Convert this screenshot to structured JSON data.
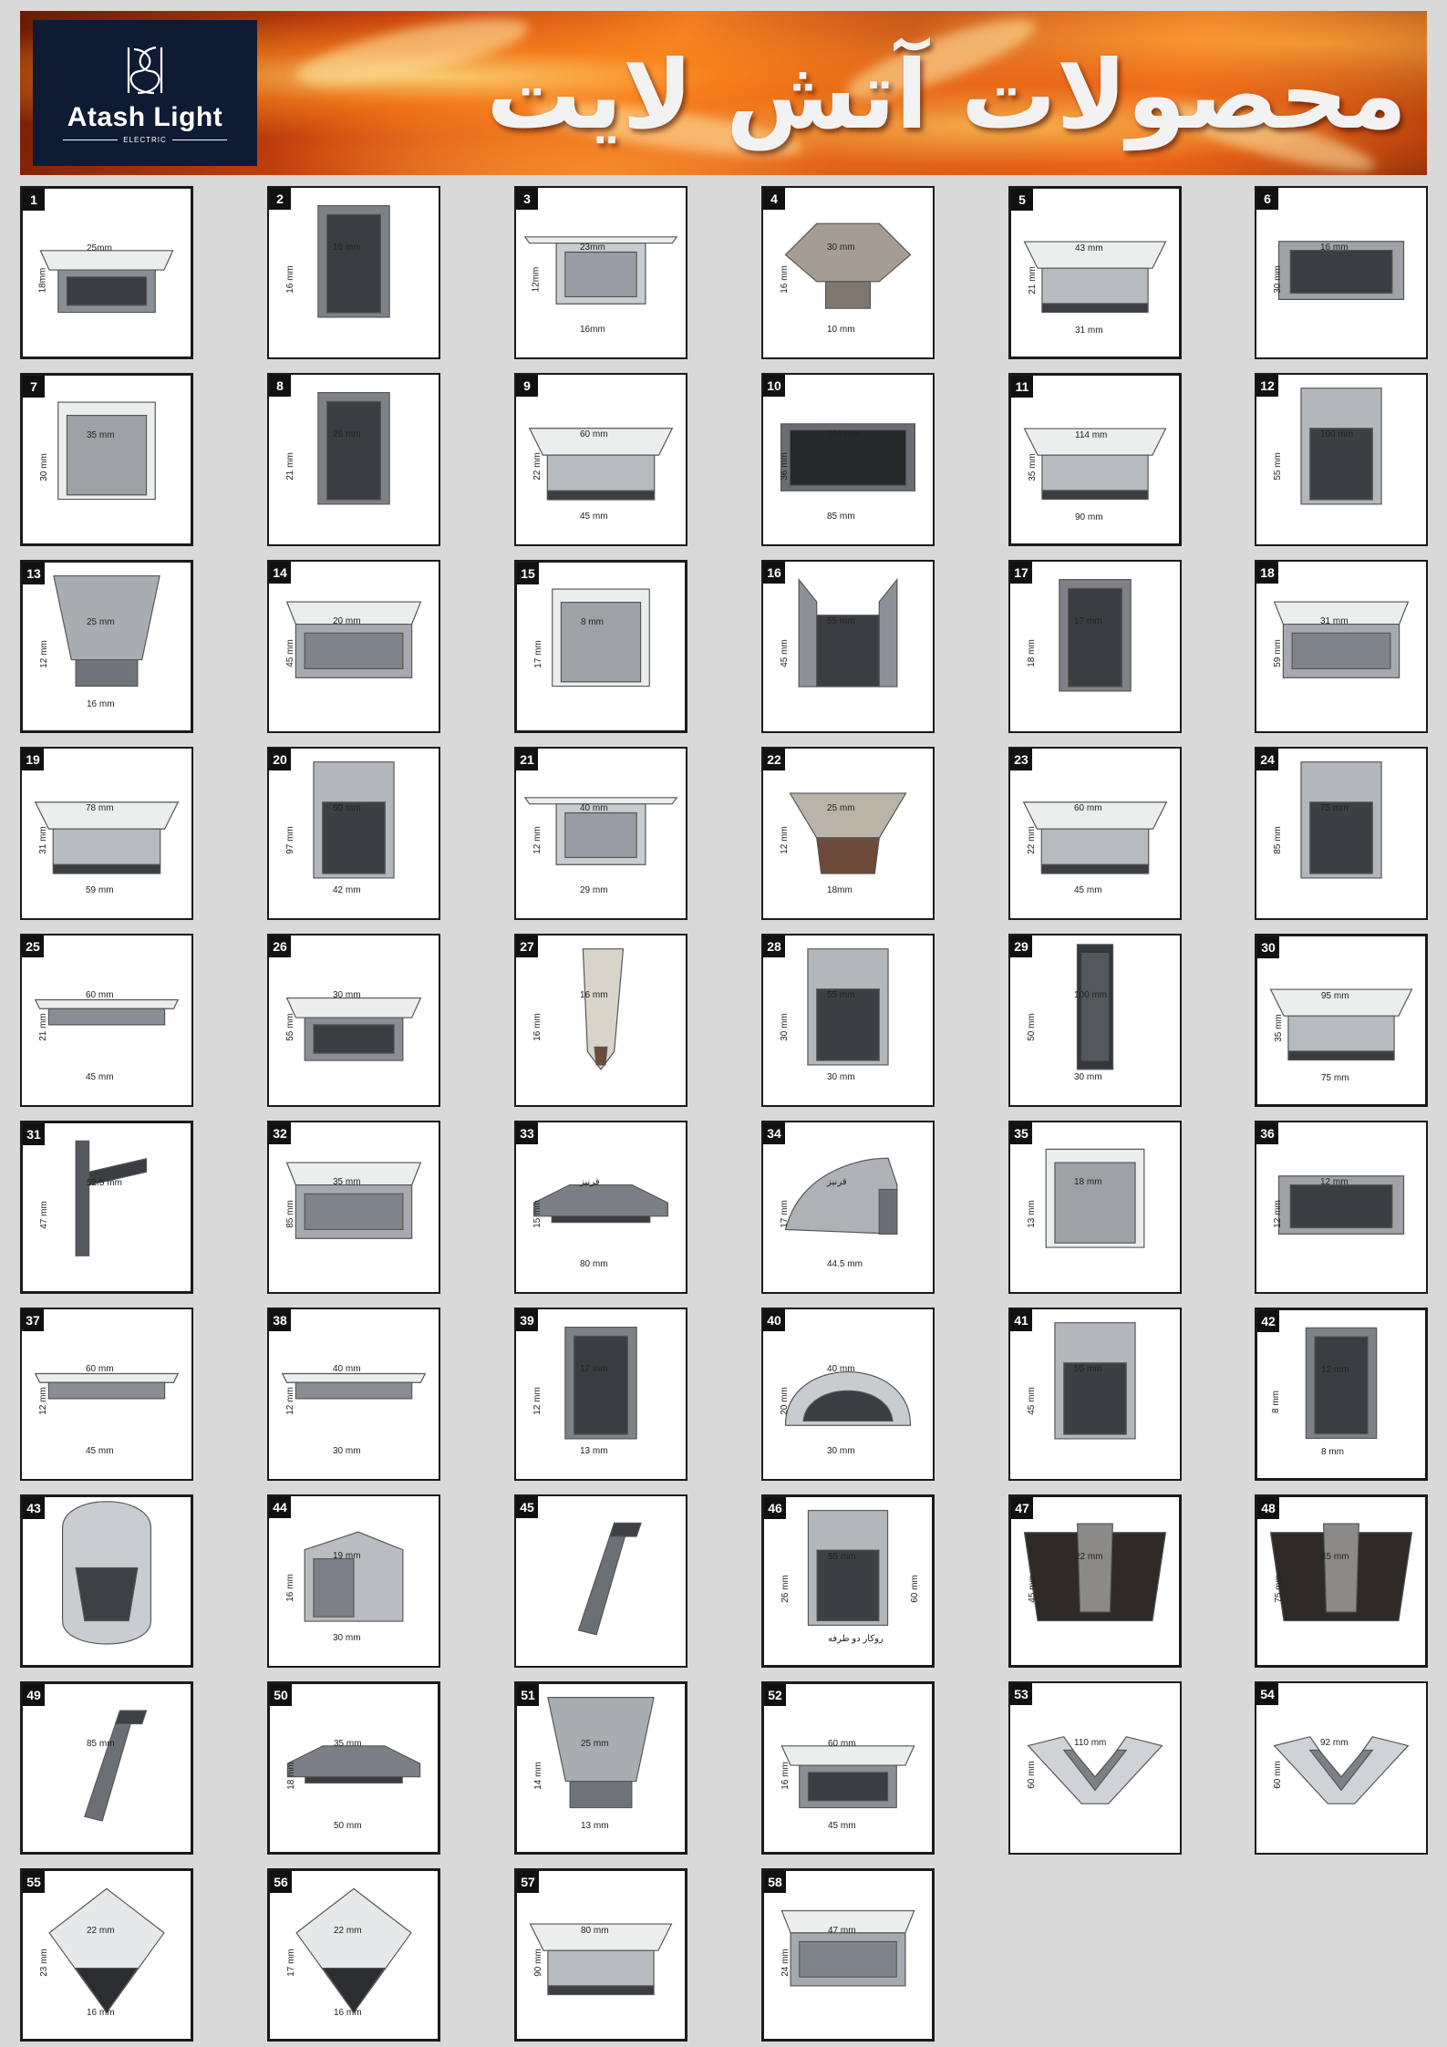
{
  "brand": {
    "name": "Atash Light",
    "subtitle": "ELECTRIC"
  },
  "banner": {
    "title": "محصولات آتش لایت"
  },
  "colors": {
    "page_bg": "#d9d9d9",
    "logo_bg": "#0f1a33",
    "number_badge": "#111111",
    "fire": "#e8661a"
  },
  "products": [
    {
      "n": "1",
      "style": "trough-lens",
      "dims": [
        "25mm",
        "18mm"
      ]
    },
    {
      "n": "2",
      "style": "u-tall-dark",
      "dims": [
        "16 mm",
        "16 mm"
      ]
    },
    {
      "n": "3",
      "style": "trough-flange",
      "dims": [
        "23mm",
        "12mm",
        "16mm"
      ]
    },
    {
      "n": "4",
      "style": "hex-beige",
      "dims": [
        "30 mm",
        "16 mm",
        "10 mm"
      ]
    },
    {
      "n": "5",
      "style": "trough-wide",
      "dims": [
        "43 mm",
        "21 mm",
        "31 mm"
      ]
    },
    {
      "n": "6",
      "style": "u-short",
      "dims": [
        "16 mm",
        "30 mm"
      ]
    },
    {
      "n": "7",
      "style": "u-tall",
      "dims": [
        "35 mm",
        "30 mm"
      ]
    },
    {
      "n": "8",
      "style": "u-tall-dark",
      "dims": [
        "26 mm",
        "21 mm"
      ]
    },
    {
      "n": "9",
      "style": "trough-wide",
      "dims": [
        "60 mm",
        "22 mm",
        "45 mm"
      ]
    },
    {
      "n": "10",
      "style": "box-dark",
      "dims": [
        "100 mm",
        "36 mm",
        "85 mm"
      ]
    },
    {
      "n": "11",
      "style": "trough-wide",
      "dims": [
        "114 mm",
        "35 mm",
        "90 mm"
      ]
    },
    {
      "n": "12",
      "style": "box-tall",
      "dims": [
        "100 mm",
        "55 mm"
      ]
    },
    {
      "n": "13",
      "style": "u-tall-flange",
      "dims": [
        "25 mm",
        "12 mm",
        "16 mm"
      ]
    },
    {
      "n": "14",
      "style": "box",
      "dims": [
        "20 mm",
        "45 mm"
      ]
    },
    {
      "n": "15",
      "style": "u-tall",
      "dims": [
        "8 mm",
        "17 mm"
      ]
    },
    {
      "n": "16",
      "style": "box-wings",
      "dims": [
        "55 mm",
        "45 mm"
      ]
    },
    {
      "n": "17",
      "style": "u-tall-dark",
      "dims": [
        "17 mm",
        "18 mm"
      ]
    },
    {
      "n": "18",
      "style": "box",
      "dims": [
        "31 mm",
        "59 mm"
      ]
    },
    {
      "n": "19",
      "style": "trough-wide",
      "dims": [
        "78 mm",
        "31 mm",
        "59 mm"
      ]
    },
    {
      "n": "20",
      "style": "box-tall",
      "dims": [
        "60 mm",
        "97 mm",
        "42 mm"
      ]
    },
    {
      "n": "21",
      "style": "trough-flange",
      "dims": [
        "40 mm",
        "12 mm",
        "29 mm"
      ]
    },
    {
      "n": "22",
      "style": "trough-brown",
      "dims": [
        "25 mm",
        "12 mm",
        "18mm"
      ]
    },
    {
      "n": "23",
      "style": "trough-wide",
      "dims": [
        "60 mm",
        "22 mm",
        "45 mm"
      ]
    },
    {
      "n": "24",
      "style": "box-tall",
      "dims": [
        "75 mm",
        "85 mm"
      ]
    },
    {
      "n": "25",
      "style": "flat-wide",
      "dims": [
        "60 mm",
        "21 mm",
        "45 mm"
      ]
    },
    {
      "n": "26",
      "style": "trough-lens",
      "dims": [
        "30 mm",
        "55 mm"
      ]
    },
    {
      "n": "27",
      "style": "corner",
      "dims": [
        "16 mm",
        "16 mm"
      ]
    },
    {
      "n": "28",
      "style": "box-tall",
      "dims": [
        "55 mm",
        "30 mm",
        "30 mm"
      ]
    },
    {
      "n": "29",
      "style": "box-tall-dark",
      "dims": [
        "100 mm",
        "50 mm",
        "30 mm"
      ]
    },
    {
      "n": "30",
      "style": "trough-wide",
      "dims": [
        "95 mm",
        "35 mm",
        "75 mm"
      ]
    },
    {
      "n": "31",
      "style": "angle",
      "dims": [
        "52.5 mm",
        "47 mm"
      ]
    },
    {
      "n": "32",
      "style": "box",
      "dims": [
        "35 mm",
        "85 mm"
      ]
    },
    {
      "n": "33",
      "style": "flat-ramp",
      "dims": [
        "قرنیز",
        "15 mm",
        "80 mm"
      ]
    },
    {
      "n": "34",
      "style": "quarter",
      "dims": [
        "قرنیز",
        "17 mm",
        "44.5 mm"
      ]
    },
    {
      "n": "35",
      "style": "u-tall",
      "dims": [
        "18 mm",
        "13 mm"
      ]
    },
    {
      "n": "36",
      "style": "u-short",
      "dims": [
        "12 mm",
        "12 mm"
      ]
    },
    {
      "n": "37",
      "style": "flat-wide",
      "dims": [
        "60 mm",
        "12 mm",
        "45 mm"
      ]
    },
    {
      "n": "38",
      "style": "flat-wide",
      "dims": [
        "40 mm",
        "12 mm",
        "30 mm"
      ]
    },
    {
      "n": "39",
      "style": "u-tall-dark",
      "dims": [
        "17 mm",
        "12 mm",
        "13 mm"
      ]
    },
    {
      "n": "40",
      "style": "dome",
      "dims": [
        "40 mm",
        "20 mm",
        "30 mm"
      ]
    },
    {
      "n": "41",
      "style": "box-tall",
      "dims": [
        "55 mm",
        "45 mm"
      ]
    },
    {
      "n": "42",
      "style": "u-tall-dark",
      "dims": [
        "12 mm",
        "8 mm",
        "8 mm"
      ]
    },
    {
      "n": "43",
      "style": "round",
      "dims": []
    },
    {
      "n": "44",
      "style": "double",
      "dims": [
        "19 mm",
        "16 mm",
        "30 mm"
      ]
    },
    {
      "n": "45",
      "style": "slant",
      "dims": []
    },
    {
      "n": "46",
      "style": "box-tall",
      "dims": [
        "55 mm",
        "26 mm",
        "روکار دو طرفه",
        "60 mm"
      ]
    },
    {
      "n": "47",
      "style": "trough-dark",
      "dims": [
        "22 mm",
        "45 mm"
      ]
    },
    {
      "n": "48",
      "style": "trough-dark",
      "dims": [
        "45 mm",
        "75 mm"
      ]
    },
    {
      "n": "49",
      "style": "slant",
      "dims": [
        "85 mm"
      ]
    },
    {
      "n": "50",
      "style": "flat-ramp",
      "dims": [
        "35 mm",
        "18 mm",
        "50 mm"
      ]
    },
    {
      "n": "51",
      "style": "u-tall-flange",
      "dims": [
        "25 mm",
        "14 mm",
        "13 mm"
      ]
    },
    {
      "n": "52",
      "style": "trough-lens",
      "dims": [
        "60 mm",
        "16 mm",
        "45 mm"
      ]
    },
    {
      "n": "53",
      "style": "vee",
      "dims": [
        "110 mm",
        "60 mm"
      ]
    },
    {
      "n": "54",
      "style": "vee",
      "dims": [
        "92 mm",
        "60 mm"
      ]
    },
    {
      "n": "55",
      "style": "corner-tri",
      "dims": [
        "22 mm",
        "23 mm",
        "16 mm"
      ]
    },
    {
      "n": "56",
      "style": "corner-tri",
      "dims": [
        "22 mm",
        "17 mm",
        "16 mm"
      ]
    },
    {
      "n": "57",
      "style": "trough-wide",
      "dims": [
        "80 mm",
        "90 mm"
      ]
    },
    {
      "n": "58",
      "style": "box",
      "dims": [
        "47 mm",
        "24 mm"
      ]
    }
  ]
}
